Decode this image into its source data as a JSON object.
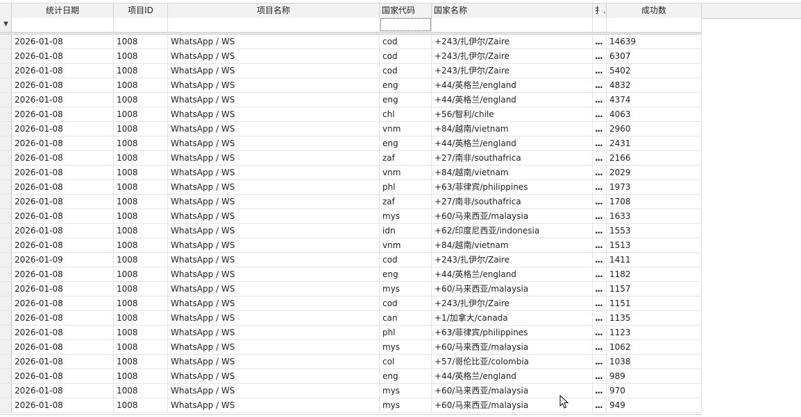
{
  "columns": [
    {
      "key": "date",
      "label": "统计日期"
    },
    {
      "key": "pid",
      "label": "项目ID"
    },
    {
      "key": "pname",
      "label": "项目名称"
    },
    {
      "key": "code",
      "label": "国家代码"
    },
    {
      "key": "country",
      "label": "国家名称"
    },
    {
      "key": "x",
      "label": "扌.."
    },
    {
      "key": "count",
      "label": "成功数"
    }
  ],
  "rows": [
    [
      "2026-01-08",
      "1008",
      "WhatsApp / WS",
      "cod",
      "+243/扎伊尔/Zaire",
      "...",
      "14639"
    ],
    [
      "2026-01-08",
      "1008",
      "WhatsApp / WS",
      "cod",
      "+243/扎伊尔/Zaire",
      "...",
      "6307"
    ],
    [
      "2026-01-08",
      "1008",
      "WhatsApp / WS",
      "cod",
      "+243/扎伊尔/Zaire",
      "...",
      "5402"
    ],
    [
      "2026-01-08",
      "1008",
      "WhatsApp / WS",
      "eng",
      "+44/英格兰/england",
      "...",
      "4832"
    ],
    [
      "2026-01-08",
      "1008",
      "WhatsApp / WS",
      "eng",
      "+44/英格兰/england",
      "...",
      "4374"
    ],
    [
      "2026-01-08",
      "1008",
      "WhatsApp / WS",
      "chl",
      "+56/智利/chile",
      "...",
      "4063"
    ],
    [
      "2026-01-08",
      "1008",
      "WhatsApp / WS",
      "vnm",
      "+84/越南/vietnam",
      "...",
      "2960"
    ],
    [
      "2026-01-08",
      "1008",
      "WhatsApp / WS",
      "eng",
      "+44/英格兰/england",
      "...",
      "2431"
    ],
    [
      "2026-01-08",
      "1008",
      "WhatsApp / WS",
      "zaf",
      "+27/南非/southafrica",
      "...",
      "2166"
    ],
    [
      "2026-01-08",
      "1008",
      "WhatsApp / WS",
      "vnm",
      "+84/越南/vietnam",
      "...",
      "2029"
    ],
    [
      "2026-01-08",
      "1008",
      "WhatsApp / WS",
      "phl",
      "+63/菲律宾/philippines",
      "...",
      "1973"
    ],
    [
      "2026-01-08",
      "1008",
      "WhatsApp / WS",
      "zaf",
      "+27/南非/southafrica",
      "...",
      "1708"
    ],
    [
      "2026-01-08",
      "1008",
      "WhatsApp / WS",
      "mys",
      "+60/马来西亚/malaysia",
      "...",
      "1633"
    ],
    [
      "2026-01-08",
      "1008",
      "WhatsApp / WS",
      "idn",
      "+62/印度尼西亚/indonesia",
      "...",
      "1553"
    ],
    [
      "2026-01-08",
      "1008",
      "WhatsApp / WS",
      "vnm",
      "+84/越南/vietnam",
      "...",
      "1513"
    ],
    [
      "2026-01-09",
      "1008",
      "WhatsApp / WS",
      "cod",
      "+243/扎伊尔/Zaire",
      "...",
      "1411"
    ],
    [
      "2026-01-08",
      "1008",
      "WhatsApp / WS",
      "eng",
      "+44/英格兰/england",
      "...",
      "1182"
    ],
    [
      "2026-01-08",
      "1008",
      "WhatsApp / WS",
      "mys",
      "+60/马来西亚/malaysia",
      "...",
      "1157"
    ],
    [
      "2026-01-08",
      "1008",
      "WhatsApp / WS",
      "cod",
      "+243/扎伊尔/Zaire",
      "...",
      "1151"
    ],
    [
      "2026-01-08",
      "1008",
      "WhatsApp / WS",
      "can",
      "+1/加拿大/canada",
      "...",
      "1135"
    ],
    [
      "2026-01-08",
      "1008",
      "WhatsApp / WS",
      "phl",
      "+63/菲律宾/philippines",
      "...",
      "1123"
    ],
    [
      "2026-01-08",
      "1008",
      "WhatsApp / WS",
      "mys",
      "+60/马来西亚/malaysia",
      "...",
      "1062"
    ],
    [
      "2026-01-08",
      "1008",
      "WhatsApp / WS",
      "col",
      "+57/哥伦比亚/colombia",
      "...",
      "1038"
    ],
    [
      "2026-01-08",
      "1008",
      "WhatsApp / WS",
      "eng",
      "+44/英格兰/england",
      "...",
      "989"
    ],
    [
      "2026-01-08",
      "1008",
      "WhatsApp / WS",
      "mys",
      "+60/马来西亚/malaysia",
      "...",
      "970"
    ],
    [
      "2026-01-08",
      "1008",
      "WhatsApp / WS",
      "mys",
      "+60/马来西亚/malaysia",
      "...",
      "949"
    ]
  ]
}
